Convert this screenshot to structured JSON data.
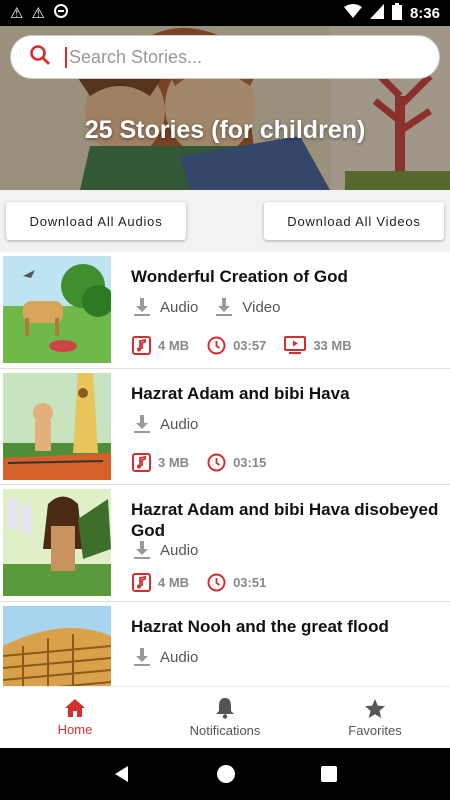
{
  "status_bar": {
    "time": "8:36"
  },
  "search": {
    "placeholder": "Search Stories..."
  },
  "header": {
    "title": "25 Stories (for children)"
  },
  "downloads": {
    "audios_label": "Download All Audios",
    "videos_label": "Download All Videos"
  },
  "stories": [
    {
      "title": "Wonderful Creation of God",
      "audio_label": "Audio",
      "video_label": "Video",
      "audio_size": "4 MB",
      "duration": "03:57",
      "video_size": "33 MB"
    },
    {
      "title": "Hazrat Adam and bibi Hava",
      "audio_label": "Audio",
      "audio_size": "3 MB",
      "duration": "03:15"
    },
    {
      "title": "Hazrat Adam and bibi Hava disobeyed God",
      "audio_label": "Audio",
      "audio_size": "4 MB",
      "duration": "03:51"
    },
    {
      "title": "Hazrat Nooh and the great flood",
      "audio_label": "Audio"
    }
  ],
  "bottom_nav": {
    "home": "Home",
    "notifications": "Notifications",
    "favorites": "Favorites"
  },
  "colors": {
    "accent": "#d32f2f",
    "meta_grey": "#888888"
  }
}
